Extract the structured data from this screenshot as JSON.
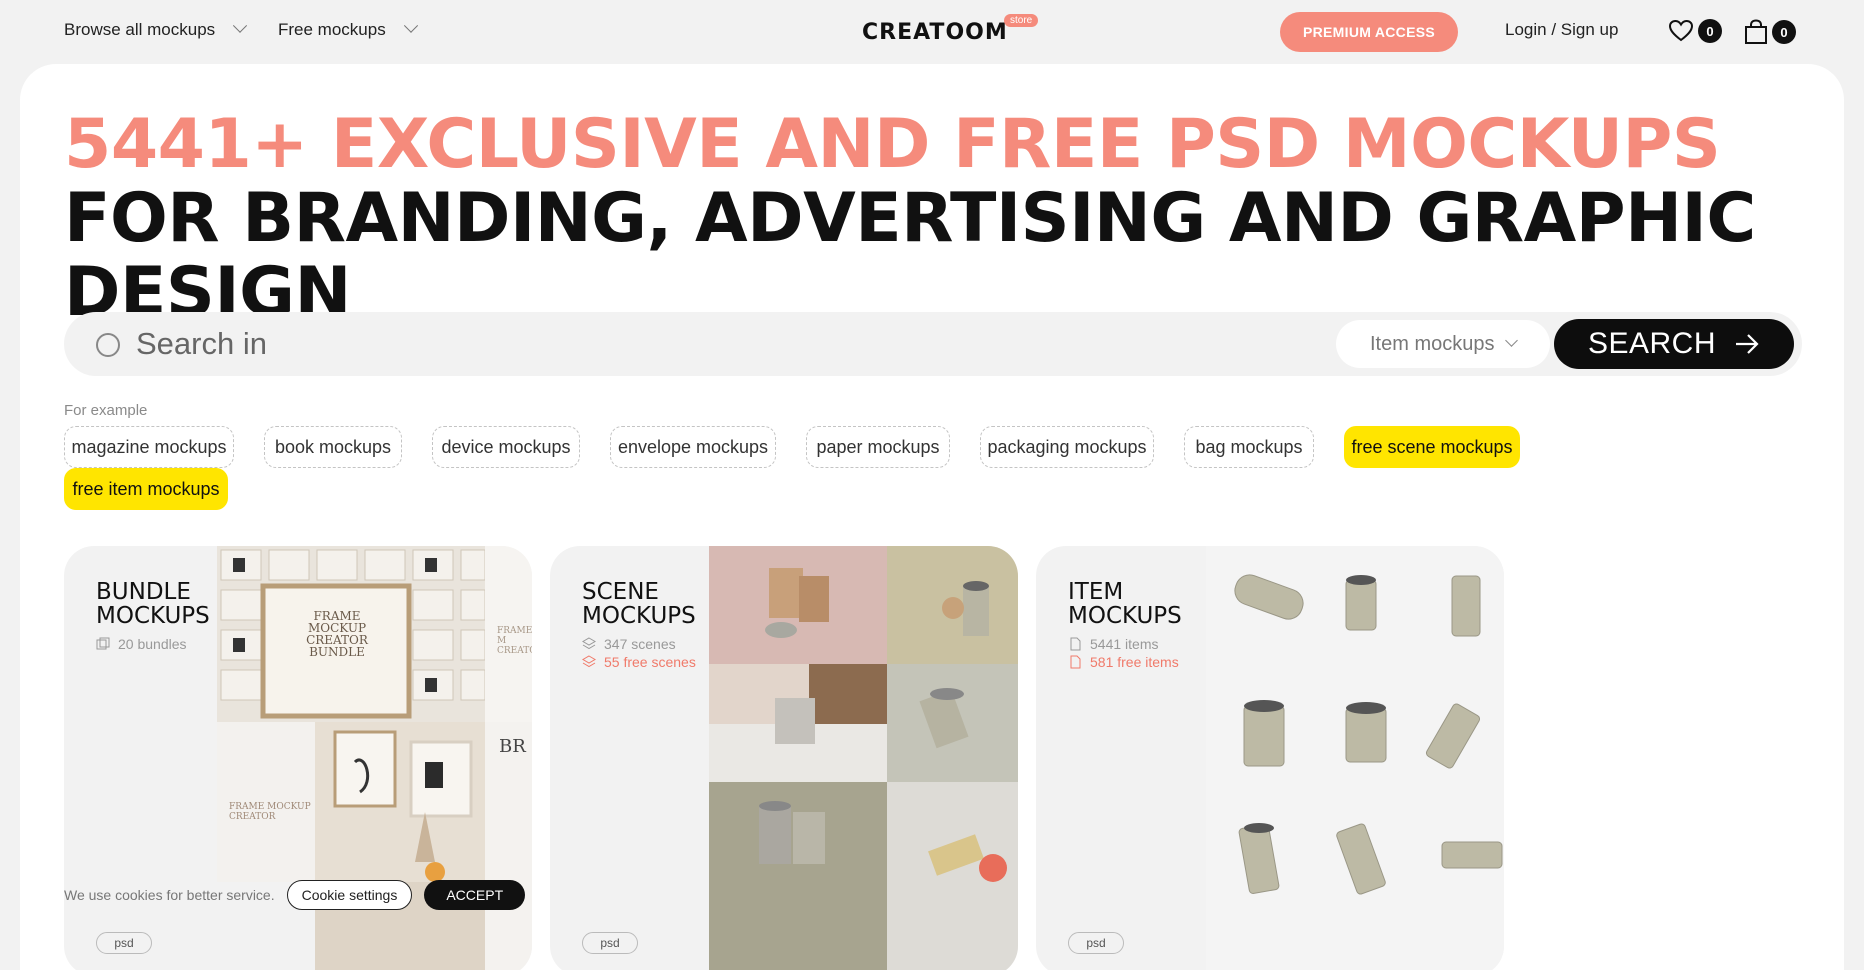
{
  "nav": {
    "browse_all": "Browse all mockups",
    "free_mockups": "Free mockups",
    "logo": "CREATOOM",
    "logo_badge": "store",
    "premium": "PREMIUM ACCESS",
    "login": "Login / Sign up",
    "wishlist_count": "0",
    "cart_count": "0"
  },
  "hero": {
    "headline_accent": "5441+ EXCLUSIVE AND FREE PSD MOCKUPS",
    "headline_rest": " FOR BRANDING, ADVERTISING AND GRAPHIC DESIGN"
  },
  "search": {
    "placeholder": "Search in",
    "category": "Item mockups",
    "button": "SEARCH"
  },
  "examples": {
    "label": "For example",
    "tags": [
      "magazine mockups",
      "book mockups",
      "device mockups",
      "envelope mockups",
      "paper mockups",
      "packaging mockups",
      "bag mockups",
      "free scene mockups",
      "free item mockups"
    ]
  },
  "cards": [
    {
      "title": "BUNDLE\nMOCKUPS",
      "stat1": "20 bundles",
      "badge": "psd",
      "preview_text_1": "FRAME\nMOCKUP\nCREATOR\nBUNDLE",
      "preview_text_2": "FRAME M\nCREATO",
      "preview_text_3": "FRAME MOCKUP\nCREATOR",
      "preview_text_4": "BR"
    },
    {
      "title": "SCENE\nMOCKUPS",
      "stat1": "347 scenes",
      "stat2": "55 free scenes",
      "badge": "psd"
    },
    {
      "title": "ITEM\nMOCKUPS",
      "stat1": "5441 items",
      "stat2": "581 free items",
      "badge": "psd"
    }
  ],
  "cookie": {
    "text": "We use cookies for better service.",
    "settings": "Cookie settings",
    "accept": "ACCEPT"
  },
  "colors": {
    "accent": "#f58b7c",
    "highlight": "#ffe500",
    "dark": "#0d0d0d"
  }
}
